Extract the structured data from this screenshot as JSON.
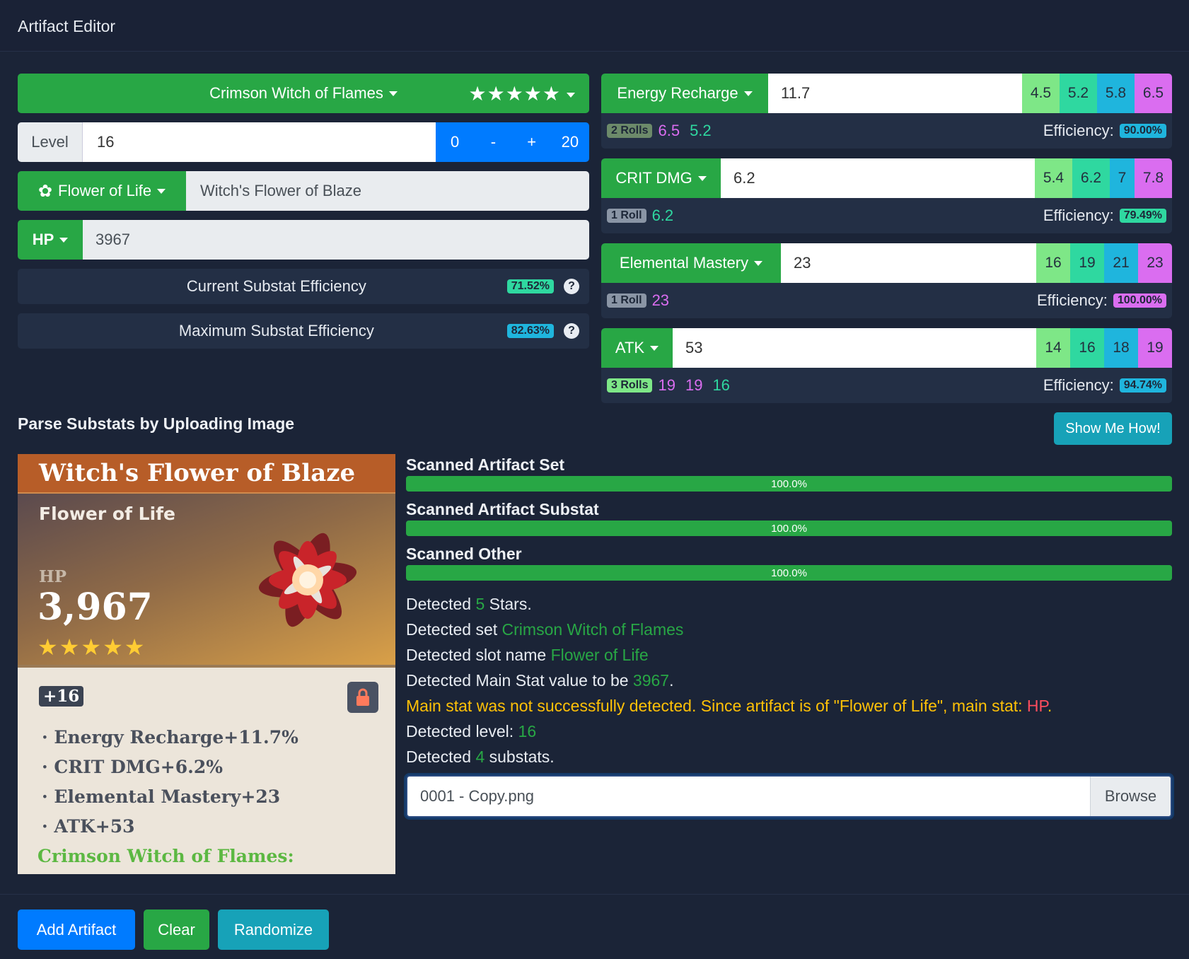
{
  "header": {
    "title": "Artifact Editor"
  },
  "editor": {
    "set_name": "Crimson Witch of Flames",
    "stars": "★★★★★",
    "level_label": "Level",
    "level_value": "16",
    "level_buttons": [
      "0",
      "-",
      "+",
      "20"
    ],
    "slot_label": "Flower of Life",
    "slot_name": "Witch's Flower of Blaze",
    "main_stat_label": "HP",
    "main_stat_value": "3967",
    "current_eff_label": "Current Substat Efficiency",
    "current_eff_value": "71.52%",
    "max_eff_label": "Maximum Substat Efficiency",
    "max_eff_value": "82.63%"
  },
  "substats": [
    {
      "name": "Energy Recharge",
      "value": "11.7",
      "rolls_options": [
        "4.5",
        "5.2",
        "5.8",
        "6.5"
      ],
      "rolls_label": "2 Rolls",
      "rolls": [
        "6.5",
        "5.2"
      ],
      "efficiency_label": "Efficiency:",
      "efficiency": "90.00%"
    },
    {
      "name": "CRIT DMG",
      "value": "6.2",
      "rolls_options": [
        "5.4",
        "6.2",
        "7",
        "7.8"
      ],
      "rolls_label": "1 Roll",
      "rolls": [
        "6.2"
      ],
      "efficiency_label": "Efficiency:",
      "efficiency": "79.49%"
    },
    {
      "name": "Elemental Mastery",
      "value": "23",
      "rolls_options": [
        "16",
        "19",
        "21",
        "23"
      ],
      "rolls_label": "1 Roll",
      "rolls": [
        "23"
      ],
      "efficiency_label": "Efficiency:",
      "efficiency": "100.00%"
    },
    {
      "name": "ATK",
      "value": "53",
      "rolls_options": [
        "14",
        "16",
        "18",
        "19"
      ],
      "rolls_label": "3 Rolls",
      "rolls": [
        "19",
        "19",
        "16"
      ],
      "efficiency_label": "Efficiency:",
      "efficiency": "94.74%"
    }
  ],
  "parse": {
    "title": "Parse Substats by Uploading Image",
    "show_me_how": "Show Me How!",
    "progress": [
      {
        "label": "Scanned Artifact Set",
        "value": 1.0,
        "text": "100.0%"
      },
      {
        "label": "Scanned Artifact Substat",
        "value": 1.0,
        "text": "100.0%"
      },
      {
        "label": "Scanned Other",
        "value": 1.0,
        "text": "100.0%"
      }
    ],
    "detections": {
      "stars_pre": "Detected ",
      "stars_val": "5",
      "stars_post": " Stars.",
      "set_pre": "Detected set ",
      "set_val": "Crimson Witch of Flames",
      "slot_pre": "Detected slot name ",
      "slot_val": "Flower of Life",
      "main_pre": "Detected Main Stat value to be ",
      "main_val": "3967",
      "main_post": ".",
      "warn_pre": "Main stat was not successfully detected. Since artifact is of \"Flower of Life\", main stat: ",
      "warn_val": "HP",
      "warn_post": ".",
      "level_pre": "Detected level: ",
      "level_val": "16",
      "sub_pre": "Detected ",
      "sub_val": "4",
      "sub_post": " substats."
    },
    "file_name": "0001 - Copy.png",
    "browse": "Browse"
  },
  "artifact_card": {
    "name": "Witch's Flower of Blaze",
    "slot": "Flower of Life",
    "main_label": "HP",
    "main_value": "3,967",
    "level": "+16",
    "substats": [
      "Energy Recharge+11.7%",
      "CRIT DMG+6.2%",
      "Elemental Mastery+23",
      "ATK+53"
    ],
    "set": "Crimson Witch of Flames:"
  },
  "actions": {
    "add": "Add Artifact",
    "clear": "Clear",
    "randomize": "Randomize"
  },
  "colors": {
    "green": "#28a745",
    "blue": "#007bff",
    "teal": "#17a2b8",
    "roll1": "#7ee787",
    "roll2": "#2fd8a0",
    "roll3": "#1fb5dd",
    "roll4": "#da6df0"
  }
}
